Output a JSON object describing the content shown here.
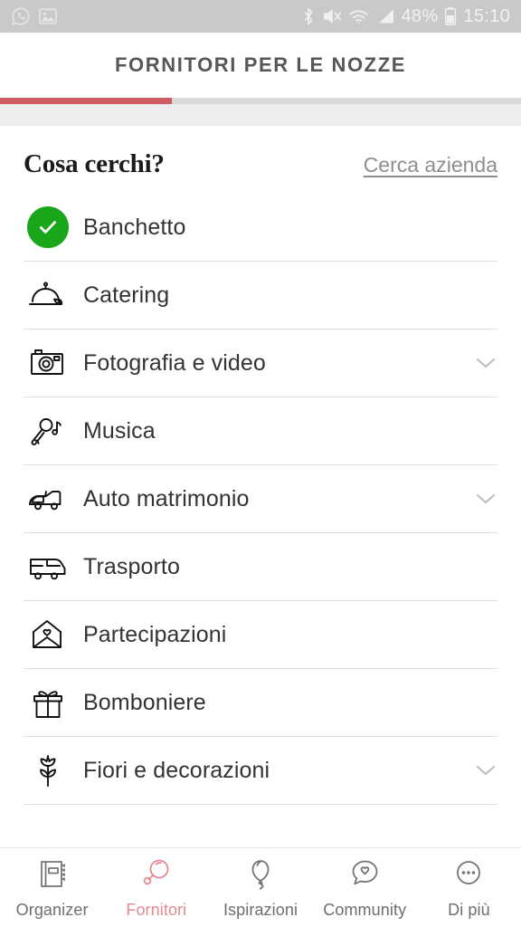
{
  "statusbar": {
    "left_icons": [
      "whatsapp-icon",
      "gallery-icon"
    ],
    "right_icons": [
      "bluetooth-icon",
      "mute-icon",
      "wifi-icon",
      "signal-icon",
      "battery-icon"
    ],
    "battery_percent": "48%",
    "time": "15:10"
  },
  "header": {
    "title": "FORNITORI PER LE NOZZE",
    "progress_percent": 33,
    "progress_color": "#cf5b63"
  },
  "main": {
    "question": "Cosa cerchi?",
    "search_link": "Cerca azienda",
    "items": [
      {
        "label": "Banchetto",
        "icon": "check-circle-icon",
        "selected": true,
        "expandable": false
      },
      {
        "label": "Catering",
        "icon": "cloche-icon",
        "selected": false,
        "expandable": false
      },
      {
        "label": "Fotografia e video",
        "icon": "camera-icon",
        "selected": false,
        "expandable": true
      },
      {
        "label": "Musica",
        "icon": "microphone-icon",
        "selected": false,
        "expandable": false
      },
      {
        "label": "Auto matrimonio",
        "icon": "car-icon",
        "selected": false,
        "expandable": true
      },
      {
        "label": "Trasporto",
        "icon": "bus-icon",
        "selected": false,
        "expandable": false
      },
      {
        "label": "Partecipazioni",
        "icon": "envelope-heart-icon",
        "selected": false,
        "expandable": false
      },
      {
        "label": "Bomboniere",
        "icon": "gift-icon",
        "selected": false,
        "expandable": false
      },
      {
        "label": "Fiori e decorazioni",
        "icon": "tulip-icon",
        "selected": false,
        "expandable": true
      }
    ]
  },
  "bottomnav": {
    "active_color": "#e28a91",
    "items": [
      {
        "label": "Organizer",
        "icon": "notebook-icon",
        "active": false
      },
      {
        "label": "Fornitori",
        "icon": "magnifier-icon",
        "active": true
      },
      {
        "label": "Ispirazioni",
        "icon": "balloon-icon",
        "active": false
      },
      {
        "label": "Community",
        "icon": "speech-heart-icon",
        "active": false
      },
      {
        "label": "Di più",
        "icon": "more-dots-icon",
        "active": false
      }
    ]
  }
}
